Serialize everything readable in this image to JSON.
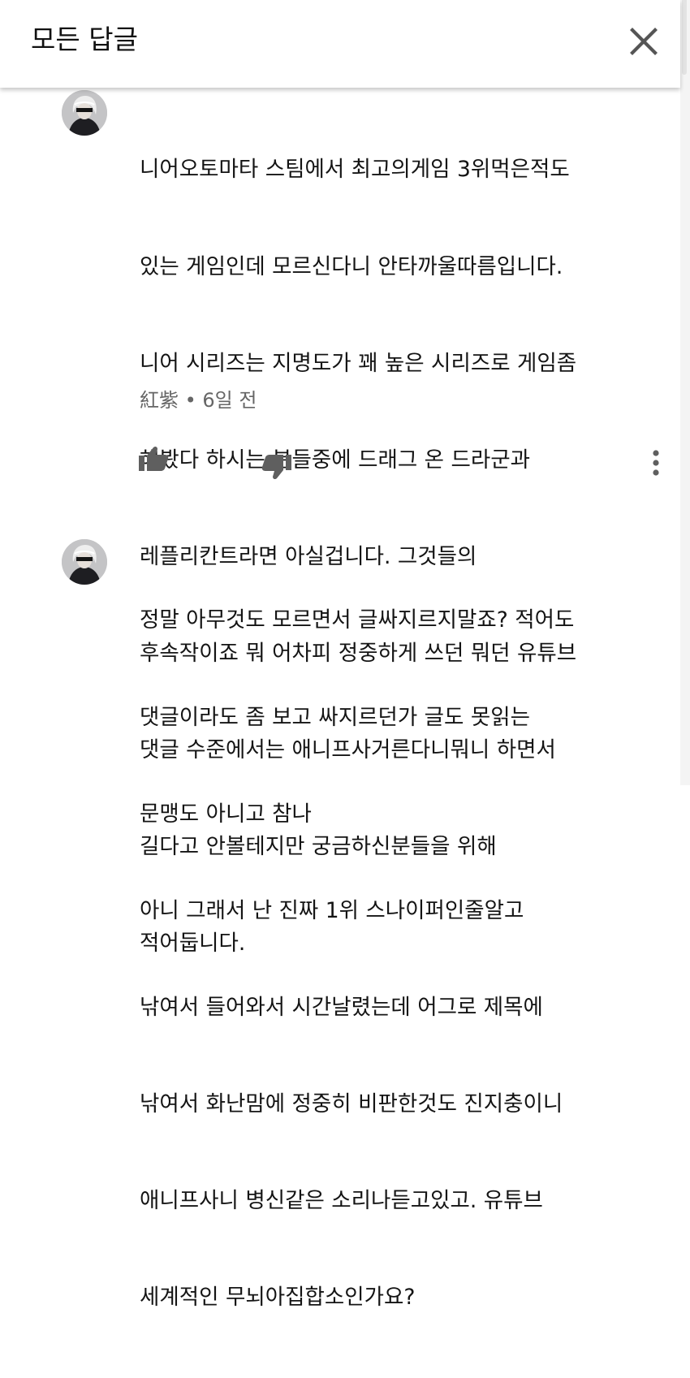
{
  "header": {
    "title": "모든 답글"
  },
  "comments": [
    {
      "lines": [
        "니어오토마타 스팀에서 최고의게임 3위먹은적도",
        "있는 게임인데 모르신다니 안타까울따름입니다.",
        "니어 시리즈는 지명도가 꽤 높은 시리즈로 게임좀",
        "해봤다 하시는 분들중에 드래그 온 드라군과",
        "레플리칸트라면 아실겁니다. 그것들의",
        "후속작이죠 뭐 어차피 정중하게 쓰던 뭐던 유튜브",
        "댓글 수준에서는 애니프사거른다니뭐니 하면서",
        "길다고 안볼테지만 궁금하신분들을 위해",
        "적어둡니다."
      ],
      "meta": "紅紫 • 6일 전"
    },
    {
      "lines": [
        "정말 아무것도 모르면서 글싸지르지말죠? 적어도",
        "댓글이라도 좀 보고 싸지르던가 글도 못읽는",
        "문맹도 아니고 참나",
        "아니 그래서 난 진짜 1위 스나이퍼인줄알고",
        "낚여서 들어와서 시간날렸는데 어그로 제목에",
        "낚여서 화난맘에 정중히 비판한것도 진지충이니",
        "애니프사니 병신같은 소리나듣고있고. 유튜브",
        "세계적인 무뇌아집합소인가요?"
      ]
    }
  ],
  "icons": {
    "close": "close-icon",
    "like": "thumbs-up-icon",
    "dislike": "thumbs-down-icon",
    "more": "more-vert-icon",
    "avatar": "user-avatar"
  },
  "colors": {
    "text": "#141414",
    "meta": "#666666",
    "icon": "#5f5f5f"
  }
}
